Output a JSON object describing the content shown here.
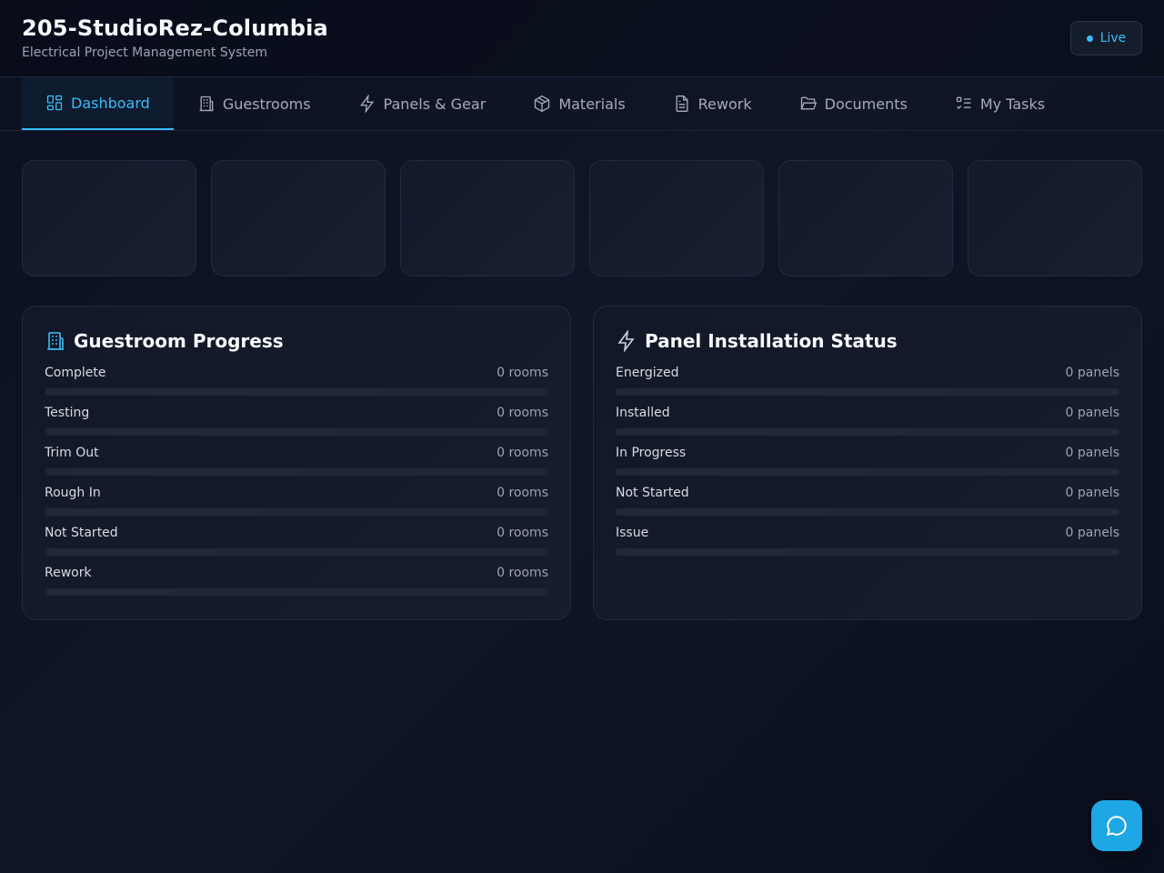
{
  "header": {
    "title": "205-StudioRez-Columbia",
    "subtitle": "Electrical Project Management System",
    "live_label": "Live"
  },
  "nav": {
    "tabs": [
      {
        "label": "Dashboard",
        "icon": "dashboard-icon",
        "active": true
      },
      {
        "label": "Guestrooms",
        "icon": "building-icon"
      },
      {
        "label": "Panels & Gear",
        "icon": "lightning-icon"
      },
      {
        "label": "Materials",
        "icon": "box-icon"
      },
      {
        "label": "Rework",
        "icon": "document-icon"
      },
      {
        "label": "Documents",
        "icon": "folder-icon"
      },
      {
        "label": "My Tasks",
        "icon": "task-list-icon"
      }
    ]
  },
  "stats": [
    {},
    {},
    {},
    {},
    {},
    {}
  ],
  "guestroom_progress": {
    "title": "Guestroom Progress",
    "icon": "building-icon",
    "rows": [
      {
        "label": "Complete",
        "value": "0 rooms",
        "fraction": 0
      },
      {
        "label": "Testing",
        "value": "0 rooms",
        "fraction": 0
      },
      {
        "label": "Trim Out",
        "value": "0 rooms",
        "fraction": 0
      },
      {
        "label": "Rough In",
        "value": "0 rooms",
        "fraction": 0
      },
      {
        "label": "Not Started",
        "value": "0 rooms",
        "fraction": 0
      },
      {
        "label": "Rework",
        "value": "0 rooms",
        "fraction": 0
      }
    ]
  },
  "panel_status": {
    "title": "Panel Installation Status",
    "icon": "lightning-icon",
    "rows": [
      {
        "label": "Energized",
        "value": "0 panels",
        "fraction": 0
      },
      {
        "label": "Installed",
        "value": "0 panels",
        "fraction": 0
      },
      {
        "label": "In Progress",
        "value": "0 panels",
        "fraction": 0
      },
      {
        "label": "Not Started",
        "value": "0 panels",
        "fraction": 0
      },
      {
        "label": "Issue",
        "value": "0 panels",
        "fraction": 0
      }
    ]
  },
  "chat": {
    "icon": "chat-icon"
  },
  "colors": {
    "accent": "#38bdf8",
    "chat_button": "#1ea7e4"
  }
}
